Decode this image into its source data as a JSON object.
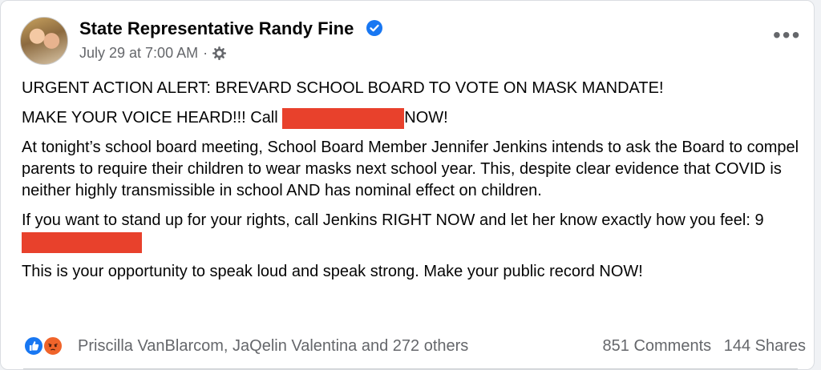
{
  "post": {
    "author": "State Representative Randy Fine",
    "timestamp": "July 29 at 7:00 AM",
    "separator": "·",
    "paragraphs": {
      "p1": "URGENT ACTION ALERT: BREVARD SCHOOL BOARD TO VOTE ON MASK MANDATE!",
      "p2a": "MAKE YOUR VOICE HEARD!!!  Call ",
      "p2b": "NOW!",
      "p3": "At tonight’s school board meeting, School Board Member Jennifer Jenkins intends to ask the Board to compel parents to require their children to wear masks next school year.    This, despite clear evidence that COVID is neither highly transmissible in school AND has nominal effect on children.",
      "p4a": "If you want to stand up for your rights, call Jenkins RIGHT NOW and let her know exactly how you feel:  9",
      "p5": "This is your opportunity to speak loud and speak strong.  Make your public record NOW!"
    }
  },
  "footer": {
    "reactors": "Priscilla VanBlarcom, JaQelin Valentina and 272 others",
    "comments": "851 Comments",
    "shares": "144 Shares"
  },
  "colors": {
    "redaction": "#e8412c",
    "verified": "#1877f2",
    "like": "#1877f2",
    "angry": "#f0642a"
  },
  "icons": [
    "profile-avatar",
    "verified-badge-icon",
    "gear-icon",
    "more-options-icon",
    "like-reaction-icon",
    "angry-reaction-icon"
  ]
}
